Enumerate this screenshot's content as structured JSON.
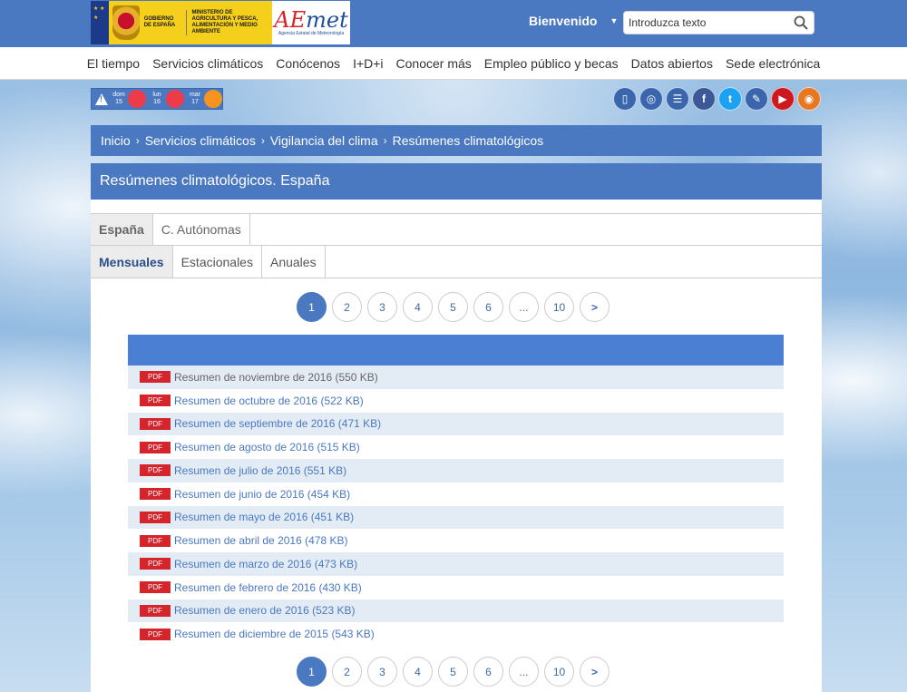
{
  "header": {
    "gov_text": "Gobierno de España",
    "ministry_text": "Ministerio de Agricultura y Pesca, Alimentación y Medio Ambiente",
    "aemet_word_a": "AE",
    "aemet_word_b": "met",
    "aemet_sub": "Agencia Estatal de Meteorología",
    "welcome": "Bienvenido",
    "search_placeholder": "Introduzca texto"
  },
  "nav": [
    "El tiempo",
    "Servicios climáticos",
    "Conócenos",
    "I+D+i",
    "Conocer más",
    "Empleo público y becas",
    "Datos abiertos",
    "Sede electrónica"
  ],
  "alerts": [
    {
      "day": "dom",
      "num": "15",
      "color": "#ee3b4a"
    },
    {
      "day": "lun",
      "num": "16",
      "color": "#ee3b4a"
    },
    {
      "day": "mar",
      "num": "17",
      "color": "#f7931e"
    }
  ],
  "social": [
    {
      "name": "mobile-icon",
      "glyph": "▯",
      "color": "#3a66ad"
    },
    {
      "name": "chatbot-icon",
      "glyph": "◎",
      "color": "#3a66ad"
    },
    {
      "name": "list-icon",
      "glyph": "☰",
      "color": "#3a66ad"
    },
    {
      "name": "facebook-icon",
      "glyph": "f",
      "color": "#3b5998"
    },
    {
      "name": "twitter-icon",
      "glyph": "t",
      "color": "#1da1f2"
    },
    {
      "name": "blog-icon",
      "glyph": "✎",
      "color": "#3a66ad"
    },
    {
      "name": "youtube-icon",
      "glyph": "▶",
      "color": "#cc181e"
    },
    {
      "name": "rss-icon",
      "glyph": "◉",
      "color": "#e87722"
    }
  ],
  "breadcrumb": [
    "Inicio",
    "Servicios climáticos",
    "Vigilancia del clima",
    "Resúmenes climatológicos"
  ],
  "page_title": "Resúmenes climatológicos. España",
  "tabs": [
    "España",
    "C. Autónomas"
  ],
  "subtabs": [
    "Mensuales",
    "Estacionales",
    "Anuales"
  ],
  "pager": [
    "1",
    "2",
    "3",
    "4",
    "5",
    "6",
    "...",
    "10",
    ">"
  ],
  "pdf_label": "PDF",
  "documents": [
    "Resumen de noviembre de 2016 (550 KB)",
    "Resumen de octubre de 2016 (522 KB)",
    "Resumen de septiembre de 2016 (471 KB)",
    "Resumen de agosto de 2016 (515 KB)",
    "Resumen de julio de 2016 (551 KB)",
    "Resumen de junio de 2016 (454 KB)",
    "Resumen de mayo de 2016 (451 KB)",
    "Resumen de abril de 2016 (478 KB)",
    "Resumen de marzo de 2016 (473 KB)",
    "Resumen de febrero de 2016 (430 KB)",
    "Resumen de enero de 2016 (523 KB)",
    "Resumen de diciembre de 2015 (543 KB)"
  ]
}
